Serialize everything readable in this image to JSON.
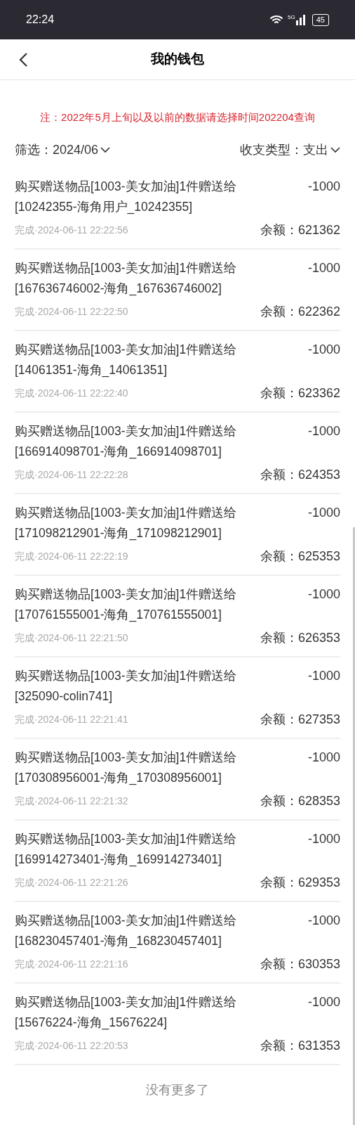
{
  "status_bar": {
    "time": "22:24",
    "network": "5G",
    "battery": "45"
  },
  "header": {
    "title": "我的钱包"
  },
  "notice": "注：2022年5月上旬以及以前的数据请选择时间202204查询",
  "filters": [
    {
      "label": "筛选：2024/06"
    },
    {
      "label": "收支类型：支出"
    }
  ],
  "transactions": [
    {
      "description": "购买赠送物品[1003-美女加油]1件赠送给[10242355-海角用户_10242355]",
      "amount": "-1000",
      "status": "完成·2024-06-11 22:22:56",
      "balance": "余额：621362"
    },
    {
      "description": "购买赠送物品[1003-美女加油]1件赠送给[167636746002-海角_167636746002]",
      "amount": "-1000",
      "status": "完成·2024-06-11 22:22:50",
      "balance": "余额：622362"
    },
    {
      "description": "购买赠送物品[1003-美女加油]1件赠送给[14061351-海角_14061351]",
      "amount": "-1000",
      "status": "完成·2024-06-11 22:22:40",
      "balance": "余额：623362"
    },
    {
      "description": "购买赠送物品[1003-美女加油]1件赠送给[166914098701-海角_166914098701]",
      "amount": "-1000",
      "status": "完成·2024-06-11 22:22:28",
      "balance": "余额：624353"
    },
    {
      "description": "购买赠送物品[1003-美女加油]1件赠送给[171098212901-海角_171098212901]",
      "amount": "-1000",
      "status": "完成·2024-06-11 22:22:19",
      "balance": "余额：625353"
    },
    {
      "description": "购买赠送物品[1003-美女加油]1件赠送给[170761555001-海角_170761555001]",
      "amount": "-1000",
      "status": "完成·2024-06-11 22:21:50",
      "balance": "余额：626353"
    },
    {
      "description": "购买赠送物品[1003-美女加油]1件赠送给[325090-colin741]",
      "amount": "-1000",
      "status": "完成·2024-06-11 22:21:41",
      "balance": "余额：627353"
    },
    {
      "description": "购买赠送物品[1003-美女加油]1件赠送给[170308956001-海角_170308956001]",
      "amount": "-1000",
      "status": "完成·2024-06-11 22:21:32",
      "balance": "余额：628353"
    },
    {
      "description": "购买赠送物品[1003-美女加油]1件赠送给[169914273401-海角_169914273401]",
      "amount": "-1000",
      "status": "完成·2024-06-11 22:21:26",
      "balance": "余额：629353"
    },
    {
      "description": "购买赠送物品[1003-美女加油]1件赠送给[168230457401-海角_168230457401]",
      "amount": "-1000",
      "status": "完成·2024-06-11 22:21:16",
      "balance": "余额：630353"
    },
    {
      "description": "购买赠送物品[1003-美女加油]1件赠送给[15676224-海角_15676224]",
      "amount": "-1000",
      "status": "完成·2024-06-11 22:20:53",
      "balance": "余额：631353"
    }
  ],
  "footer": "没有更多了"
}
